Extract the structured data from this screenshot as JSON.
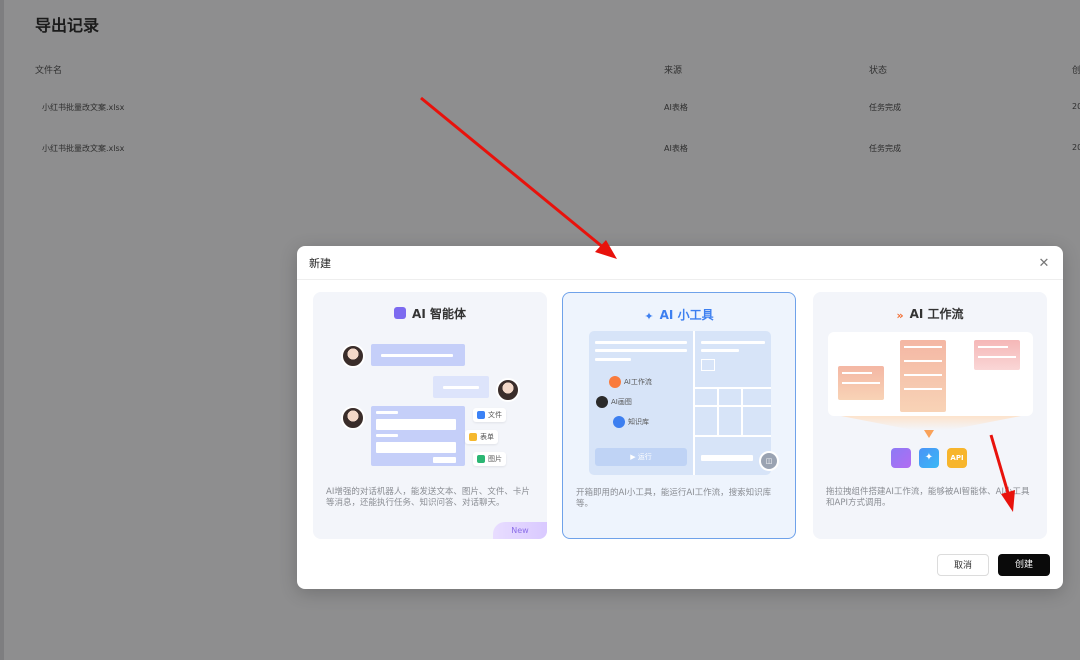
{
  "page": {
    "title": "导出记录",
    "columns": [
      "文件名",
      "来源",
      "状态",
      "创"
    ],
    "rows": [
      {
        "name": "小红书批量改文案.xlsx",
        "source": "AI表格",
        "status": "任务完成",
        "created": "20"
      },
      {
        "name": "小红书批量改文案.xlsx",
        "source": "AI表格",
        "status": "任务完成",
        "created": "20"
      }
    ]
  },
  "modal": {
    "title": "新建",
    "cards": [
      {
        "title": "AI 智能体",
        "desc": "AI增强的对话机器人，能发送文本、图片、文件、卡片等消息，还能执行任务、知识问答、对话聊天。",
        "badge": "New",
        "chips": [
          "文件",
          "表单",
          "图片"
        ]
      },
      {
        "title": "AI 小工具",
        "desc": "开箱即用的AI小工具，能运行AI工作流，搜索知识库等。",
        "tools": [
          "AI工作流",
          "AI画图",
          "知识库"
        ],
        "run_label": "运行"
      },
      {
        "title": "AI 工作流",
        "desc": "拖拉拽组件搭建AI工作流，能够被AI智能体、AI小工具和API方式调用。",
        "api_label": "API"
      }
    ],
    "cancel_label": "取消",
    "create_label": "创建"
  },
  "colors": {
    "accent_blue": "#3d7ff0",
    "selected_border": "#6fa2ea",
    "arrow_red": "#e8120c"
  }
}
